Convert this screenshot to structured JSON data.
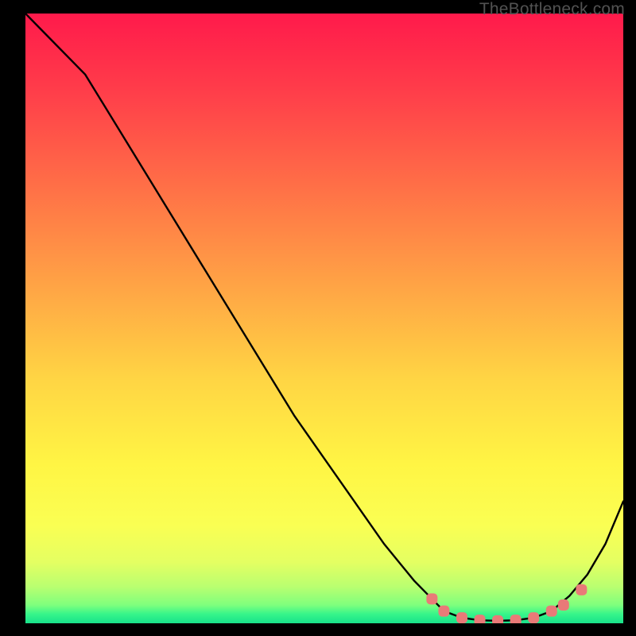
{
  "watermark": "TheBottleneck.com",
  "chart_data": {
    "type": "line",
    "title": "",
    "xlabel": "",
    "ylabel": "",
    "xlim": [
      0,
      100
    ],
    "ylim": [
      0,
      100
    ],
    "series": [
      {
        "name": "bottleneck-curve",
        "x": [
          0,
          5,
          10,
          15,
          20,
          25,
          30,
          35,
          40,
          45,
          50,
          55,
          60,
          65,
          68,
          70,
          73,
          76,
          79,
          82,
          85,
          88,
          91,
          94,
          97,
          100
        ],
        "y": [
          100,
          95,
          90,
          82,
          74,
          66,
          58,
          50,
          42,
          34,
          27,
          20,
          13,
          7,
          4,
          2,
          0.9,
          0.5,
          0.4,
          0.5,
          0.9,
          2,
          4.5,
          8,
          13,
          20
        ]
      }
    ],
    "markers": {
      "name": "optimal-marker-dots",
      "x": [
        68,
        70,
        73,
        76,
        79,
        82,
        85,
        88,
        90,
        93
      ],
      "y": [
        4,
        2,
        0.9,
        0.5,
        0.4,
        0.5,
        0.9,
        2,
        3,
        5.5
      ]
    },
    "gradient_stops": [
      {
        "pos": 0.0,
        "color": "#ff1a4b"
      },
      {
        "pos": 0.12,
        "color": "#ff3b4a"
      },
      {
        "pos": 0.28,
        "color": "#ff6e47"
      },
      {
        "pos": 0.45,
        "color": "#ffa545"
      },
      {
        "pos": 0.6,
        "color": "#ffd544"
      },
      {
        "pos": 0.74,
        "color": "#fff544"
      },
      {
        "pos": 0.84,
        "color": "#faff53"
      },
      {
        "pos": 0.9,
        "color": "#e4ff62"
      },
      {
        "pos": 0.94,
        "color": "#b9ff70"
      },
      {
        "pos": 0.97,
        "color": "#7fff7d"
      },
      {
        "pos": 0.985,
        "color": "#36f58a"
      },
      {
        "pos": 1.0,
        "color": "#18e28b"
      }
    ]
  }
}
